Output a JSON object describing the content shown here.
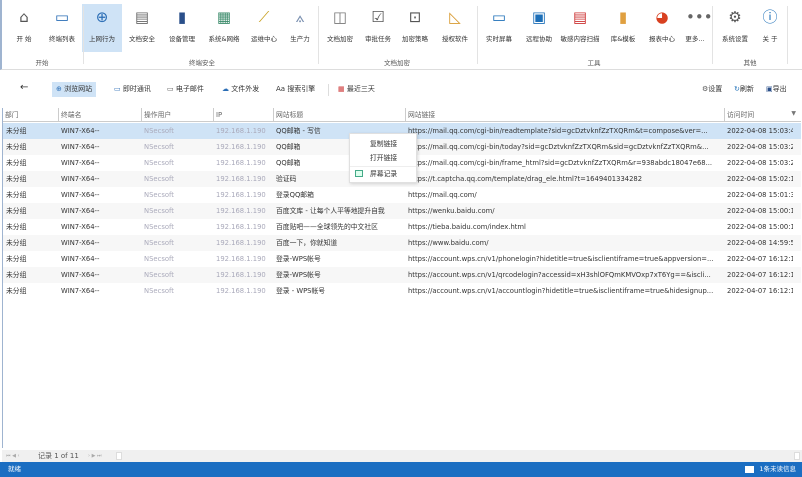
{
  "ribbon": {
    "buttons": [
      {
        "label": "开 始",
        "icon": "home-icon"
      },
      {
        "label": "终端列表",
        "icon": "computers-icon"
      },
      {
        "label": "上网行为",
        "icon": "globe-search-icon",
        "selected": true
      },
      {
        "label": "文档安全",
        "icon": "document-shield-icon"
      },
      {
        "label": "设备管理",
        "icon": "usb-device-icon"
      },
      {
        "label": "系统&网络",
        "icon": "firewall-shield-icon"
      },
      {
        "label": "运维中心",
        "icon": "magic-wand-icon"
      },
      {
        "label": "生产力",
        "icon": "chart-user-icon"
      },
      {
        "label": "文档加密",
        "icon": "cube-shield-icon"
      },
      {
        "label": "审批任务",
        "icon": "clipboard-check-icon"
      },
      {
        "label": "加密策略",
        "icon": "lock-window-icon"
      },
      {
        "label": "授权软件",
        "icon": "ruler-pencil-icon"
      },
      {
        "label": "实时屏幕",
        "icon": "monitor-icon"
      },
      {
        "label": "远程协助",
        "icon": "remote-screens-icon"
      },
      {
        "label": "敏感内容扫描",
        "icon": "scanner-icon"
      },
      {
        "label": "库&模板",
        "icon": "database-icon"
      },
      {
        "label": "报表中心",
        "icon": "pie-chart-icon"
      },
      {
        "label": "更多...",
        "icon": "more-icon"
      },
      {
        "label": "系统设置",
        "icon": "gear-icon"
      },
      {
        "label": "关 于",
        "icon": "info-icon"
      }
    ],
    "groups": [
      "开始",
      "终端安全",
      "文档加密",
      "工具",
      "其他"
    ]
  },
  "toolbar": {
    "back_icon": "arrow-left-icon",
    "tabs": [
      {
        "label": "浏览网站",
        "icon": "globe-icon",
        "selected": true
      },
      {
        "label": "即时通讯",
        "icon": "chat-icon"
      },
      {
        "label": "电子邮件",
        "icon": "mail-icon"
      },
      {
        "label": "文件外发",
        "icon": "cloud-upload-icon"
      },
      {
        "label": "搜索引擎",
        "icon": "font-aa-icon"
      }
    ],
    "date_filter": "最近三天",
    "settings": "设置",
    "refresh": "刷新",
    "export": "导出"
  },
  "table": {
    "columns": [
      "部门",
      "终端名",
      "操作用户",
      "IP",
      "网站标题",
      "网站链接",
      "访问时间"
    ],
    "rows": [
      [
        "未分组",
        "WIN7-X64--",
        "NSecsoft",
        "192.168.1.190",
        "QQ邮箱 - 写信",
        "https://mail.qq.com/cgi-bin/readtemplate?sid=gcDztvknfZzTXQRm&t=compose&ver=...",
        "2022-04-08 15:03:47"
      ],
      [
        "未分组",
        "WIN7-X64--",
        "NSecsoft",
        "192.168.1.190",
        "QQ邮箱",
        "https://mail.qq.com/cgi-bin/today?sid=gcDztvknfZzTXQRm&sid=gcDztvknfZzTXQRm&...",
        "2022-04-08 15:03:24"
      ],
      [
        "未分组",
        "WIN7-X64--",
        "NSecsoft",
        "192.168.1.190",
        "QQ邮箱",
        "https://mail.qq.com/cgi-bin/frame_html?sid=gcDztvknfZzTXQRm&r=938abdc18047e68...",
        "2022-04-08 15:03:20"
      ],
      [
        "未分组",
        "WIN7-X64--",
        "NSecsoft",
        "192.168.1.190",
        "验证码",
        "https://t.captcha.qq.com/template/drag_ele.html?t=1649401334282",
        "2022-04-08 15:02:14"
      ],
      [
        "未分组",
        "WIN7-X64--",
        "NSecsoft",
        "192.168.1.190",
        "登录QQ邮箱",
        "https://mail.qq.com/",
        "2022-04-08 15:01:37"
      ],
      [
        "未分组",
        "WIN7-X64--",
        "NSecsoft",
        "192.168.1.190",
        "百度文库 - 让每个人平等地提升自我",
        "https://wenku.baidu.com/",
        "2022-04-08 15:00:19"
      ],
      [
        "未分组",
        "WIN7-X64--",
        "NSecsoft",
        "192.168.1.190",
        "百度贴吧——全球领先的中文社区",
        "https://tieba.baidu.com/index.html",
        "2022-04-08 15:00:12"
      ],
      [
        "未分组",
        "WIN7-X64--",
        "NSecsoft",
        "192.168.1.190",
        "百度一下，你就知道",
        "https://www.baidu.com/",
        "2022-04-08 14:59:50"
      ],
      [
        "未分组",
        "WIN7-X64--",
        "NSecsoft",
        "192.168.1.190",
        "登录-WPS帐号",
        "https://account.wps.cn/v1/phonelogin?hidetitle=true&isclientiframe=true&appversion=...",
        "2022-04-07 16:12:15"
      ],
      [
        "未分组",
        "WIN7-X64--",
        "NSecsoft",
        "192.168.1.190",
        "登录-WPS帐号",
        "https://account.wps.cn/v1/qrcodelogin?accessid=xH3shlOFQmKMVOxp7xT6Yg==&iscli...",
        "2022-04-07 16:12:15"
      ],
      [
        "未分组",
        "WIN7-X64--",
        "NSecsoft",
        "192.168.1.190",
        "登录 - WPS帐号",
        "https://account.wps.cn/v1/accountlogin?hidetitle=true&isclientiframe=true&hidesignup...",
        "2022-04-07 16:12:14"
      ]
    ]
  },
  "context_menu": {
    "items": [
      "复制链接",
      "打开链接",
      "屏幕记录"
    ]
  },
  "pager": {
    "text": "记录 1 of 11"
  },
  "status": {
    "left": "就绪",
    "right": "1条未读信息"
  },
  "colors": {
    "accent": "#1b6ec2",
    "selected": "#cfe3f6"
  }
}
